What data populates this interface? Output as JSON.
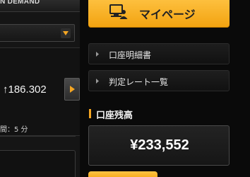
{
  "left_panel": {
    "header_title": "ON DEMAND",
    "rate_value": "↑186.302",
    "interval_label": "間：5 分"
  },
  "right_panel": {
    "mypage_label": "マイページ",
    "menu_items": [
      {
        "label": "口座明細書",
        "icon": "chevron-right-icon"
      },
      {
        "label": "判定レート一覧",
        "icon": "chevron-right-icon"
      }
    ],
    "balance_title": "口座残高",
    "balance_value": "¥233,552"
  },
  "colors": {
    "accent": "#f5a623",
    "background": "#0a0a0a",
    "panel": "#151515",
    "text": "#e8e8e8"
  }
}
